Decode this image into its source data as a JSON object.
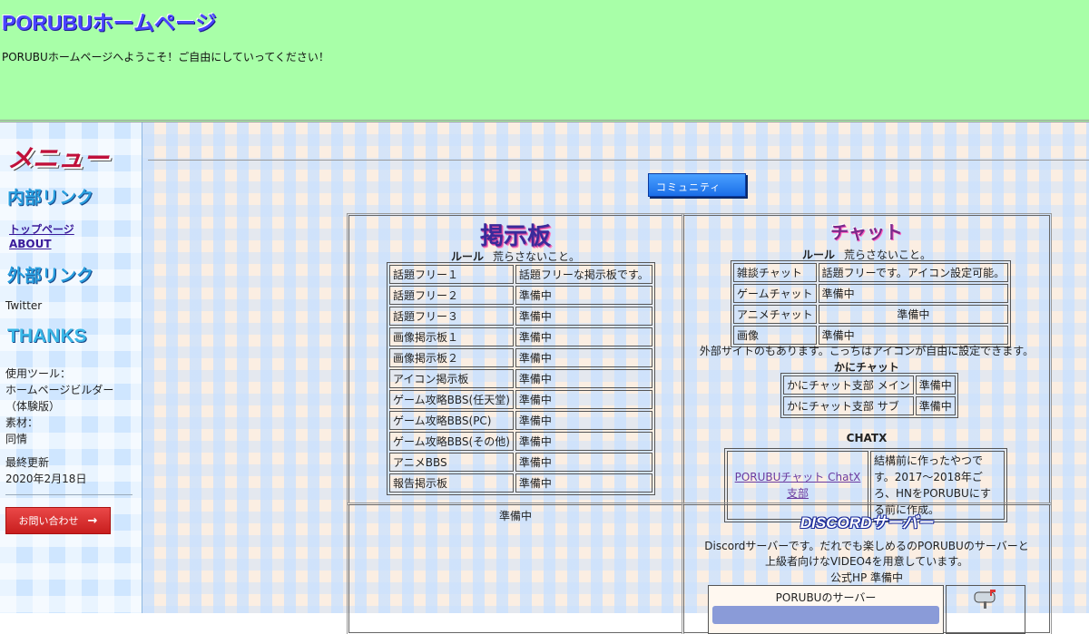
{
  "header": {
    "title": "PORUBUホームページ",
    "welcome": "PORUBUホームページへようこそ！ご自由にしていってください！"
  },
  "sidebar": {
    "menu_heading": "メニュー",
    "internal_heading": "内部リンク",
    "internal_links": [
      "トップページ",
      "ABOUT"
    ],
    "external_heading": "外部リンク",
    "external_links": [
      "Twitter"
    ],
    "thanks_heading": "THANKS",
    "tools_lines": [
      "使用ツール：",
      "ホームページビルダー",
      "（体験版）",
      "素材：",
      "同情"
    ],
    "updated_lines": [
      "最終更新",
      "2020年2月18日"
    ],
    "contact_label": "お問い合わせ",
    "contact_arrow": "→"
  },
  "main": {
    "community_button": "コミュニティ",
    "bbs": {
      "title": "掲示板",
      "rule_label": "ルール",
      "rule_text": "荒らさないこと。",
      "rows": [
        [
          "話題フリー１",
          "話題フリーな掲示板です。"
        ],
        [
          "話題フリー２",
          "準備中"
        ],
        [
          "話題フリー３",
          "準備中"
        ],
        [
          "画像掲示板１",
          "準備中"
        ],
        [
          "画像掲示板２",
          "準備中"
        ],
        [
          "アイコン掲示板",
          "準備中"
        ],
        [
          "ゲーム攻略BBS(任天堂)",
          "準備中"
        ],
        [
          "ゲーム攻略BBS(PC)",
          "準備中"
        ],
        [
          "ゲーム攻略BBS(その他)",
          "準備中"
        ],
        [
          "アニメBBS",
          "準備中"
        ],
        [
          "報告掲示板",
          "準備中"
        ]
      ]
    },
    "chat": {
      "title": "チャット",
      "rule_label": "ルール",
      "rule_text": "荒らさないこと。",
      "rows": [
        [
          "雑談チャット",
          "話題フリーです。アイコン設定可能。"
        ],
        [
          "ゲームチャット",
          "準備中"
        ],
        [
          "アニメチャット",
          "準備中"
        ],
        [
          "画像",
          "準備中"
        ]
      ],
      "external_note": "外部サイトのもあります。こっちはアイコンが自由に設定できます。",
      "crab_heading": "かにチャット",
      "crab_rows": [
        [
          "かにチャット支部 メイン",
          "準備中"
        ],
        [
          "かにチャット支部 サブ",
          "準備中"
        ]
      ],
      "chatx_heading": "CHATX",
      "chatx_link": "PORUBUチャット ChatX支部",
      "chatx_desc": "結構前に作ったやつです。2017～2018年ごろ、HNをPORUBUにする前に作成。"
    },
    "empty_panel": {
      "text": "準備中"
    },
    "discord": {
      "title": "DISCORDサーバー",
      "desc_lines": [
        "Discordサーバーです。だれでも楽しめるのPORUBUのサーバーと",
        "上級者向けなVIDEO4を用意しています。"
      ],
      "hp": "公式HP 準備中",
      "server_label": "PORUBUのサーバー"
    }
  },
  "colors": {
    "header_bg": "#a8ffa8",
    "title": "#4a44ff",
    "contact_button": "#d92a2a",
    "community_button": "#1a6ee8"
  }
}
